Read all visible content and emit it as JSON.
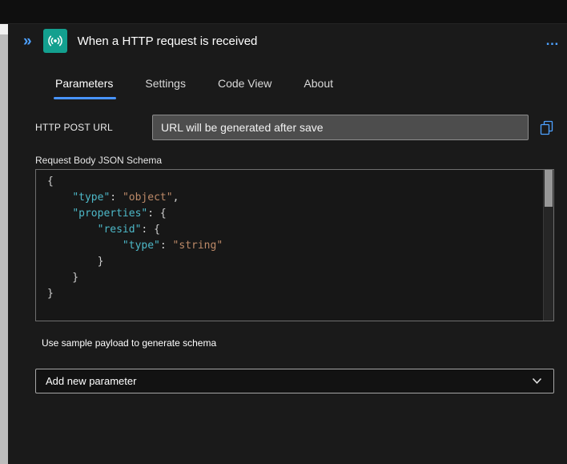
{
  "header": {
    "title": "When a HTTP request is received",
    "expand_icon": "»",
    "menu_icon": "…"
  },
  "tabs": [
    {
      "label": "Parameters",
      "active": true
    },
    {
      "label": "Settings",
      "active": false
    },
    {
      "label": "Code View",
      "active": false
    },
    {
      "label": "About",
      "active": false
    }
  ],
  "http_post_url": {
    "label": "HTTP POST URL",
    "value": "URL will be generated after save"
  },
  "schema_editor": {
    "label": "Request Body JSON Schema",
    "lines": [
      [
        {
          "type": "plain",
          "text": "{"
        }
      ],
      [
        {
          "type": "plain",
          "text": "    "
        },
        {
          "type": "key",
          "text": "\"type\""
        },
        {
          "type": "plain",
          "text": ": "
        },
        {
          "type": "str",
          "text": "\"object\""
        },
        {
          "type": "plain",
          "text": ","
        }
      ],
      [
        {
          "type": "plain",
          "text": "    "
        },
        {
          "type": "key",
          "text": "\"properties\""
        },
        {
          "type": "plain",
          "text": ": {"
        }
      ],
      [
        {
          "type": "plain",
          "text": "        "
        },
        {
          "type": "key",
          "text": "\"resid\""
        },
        {
          "type": "plain",
          "text": ": {"
        }
      ],
      [
        {
          "type": "plain",
          "text": "            "
        },
        {
          "type": "key",
          "text": "\"type\""
        },
        {
          "type": "plain",
          "text": ": "
        },
        {
          "type": "str",
          "text": "\"string\""
        }
      ],
      [
        {
          "type": "plain",
          "text": "        }"
        }
      ],
      [
        {
          "type": "plain",
          "text": "    }"
        }
      ],
      [
        {
          "type": "plain",
          "text": "}"
        }
      ]
    ]
  },
  "sample_payload_link": "Use sample payload to generate schema",
  "add_parameter": {
    "label": "Add new parameter"
  },
  "colors": {
    "accent_blue": "#4da1ff",
    "tab_underline": "#4894ff",
    "trigger_teal": "#13a08f",
    "code_key": "#4db8c8",
    "code_string": "#bd8a68",
    "input_bg": "#4d4d4d"
  }
}
